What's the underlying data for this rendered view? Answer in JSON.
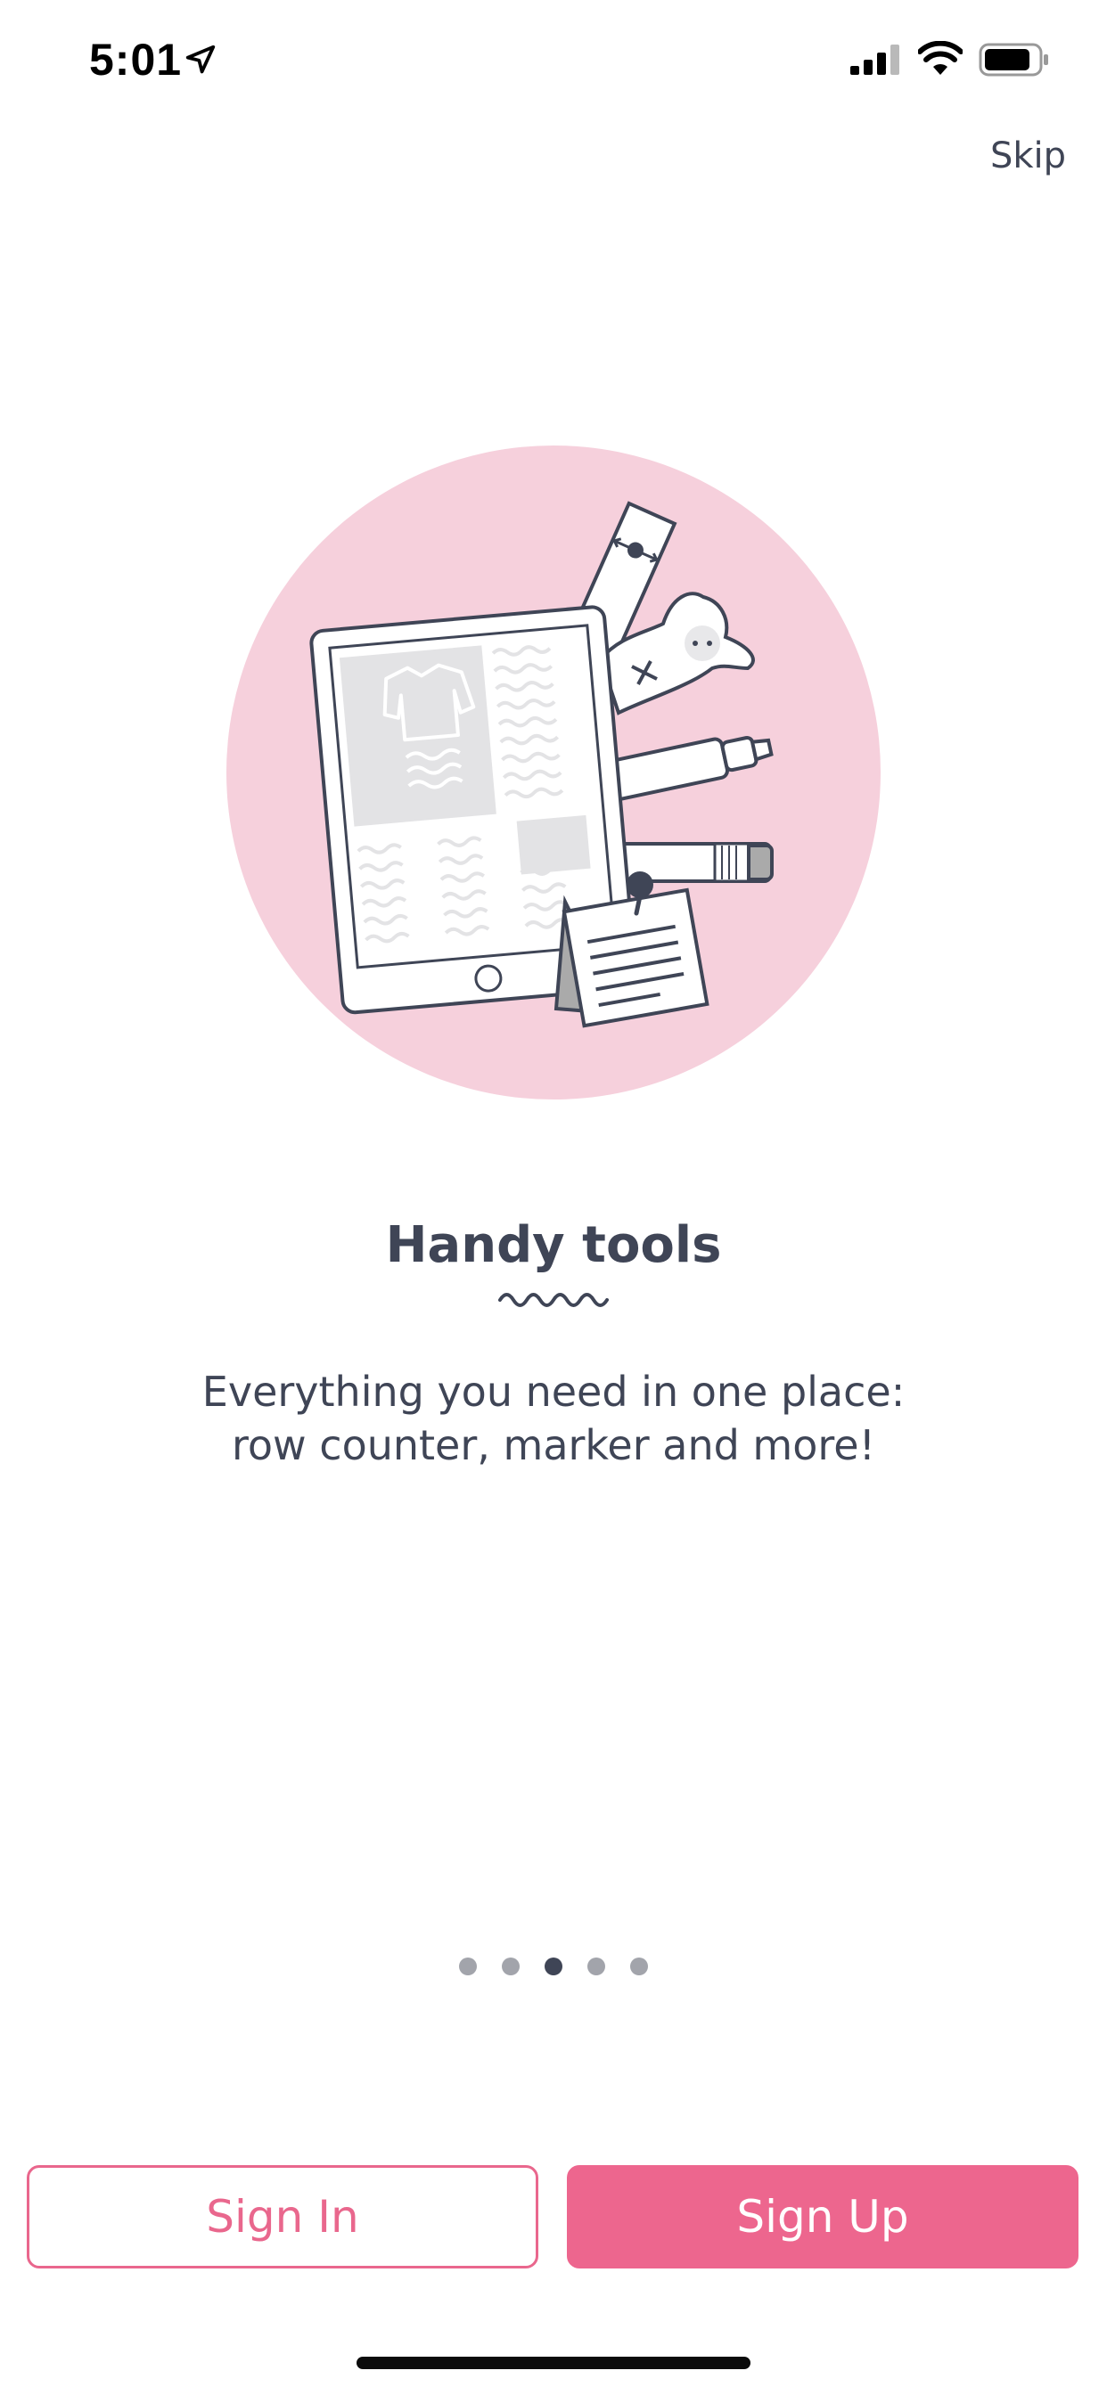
{
  "status_bar": {
    "time": "5:01",
    "icons": [
      "location-arrow-icon",
      "cellular-signal-icon",
      "wifi-icon",
      "battery-icon"
    ]
  },
  "header": {
    "skip_label": "Skip"
  },
  "illustration": {
    "name": "handy-tools-illustration",
    "circle_color": "#f6d0dc"
  },
  "feature": {
    "title": "Handy tools",
    "description_lines": [
      "Everything you need in one place:",
      "row counter, marker and more!"
    ]
  },
  "pagination": {
    "total": 5,
    "current": 3
  },
  "actions": {
    "sign_in_label": "Sign In",
    "sign_up_label": "Sign Up"
  },
  "colors": {
    "accent": "#ed668e",
    "text": "#3f4556",
    "dot_inactive": "#a2a4ab"
  }
}
